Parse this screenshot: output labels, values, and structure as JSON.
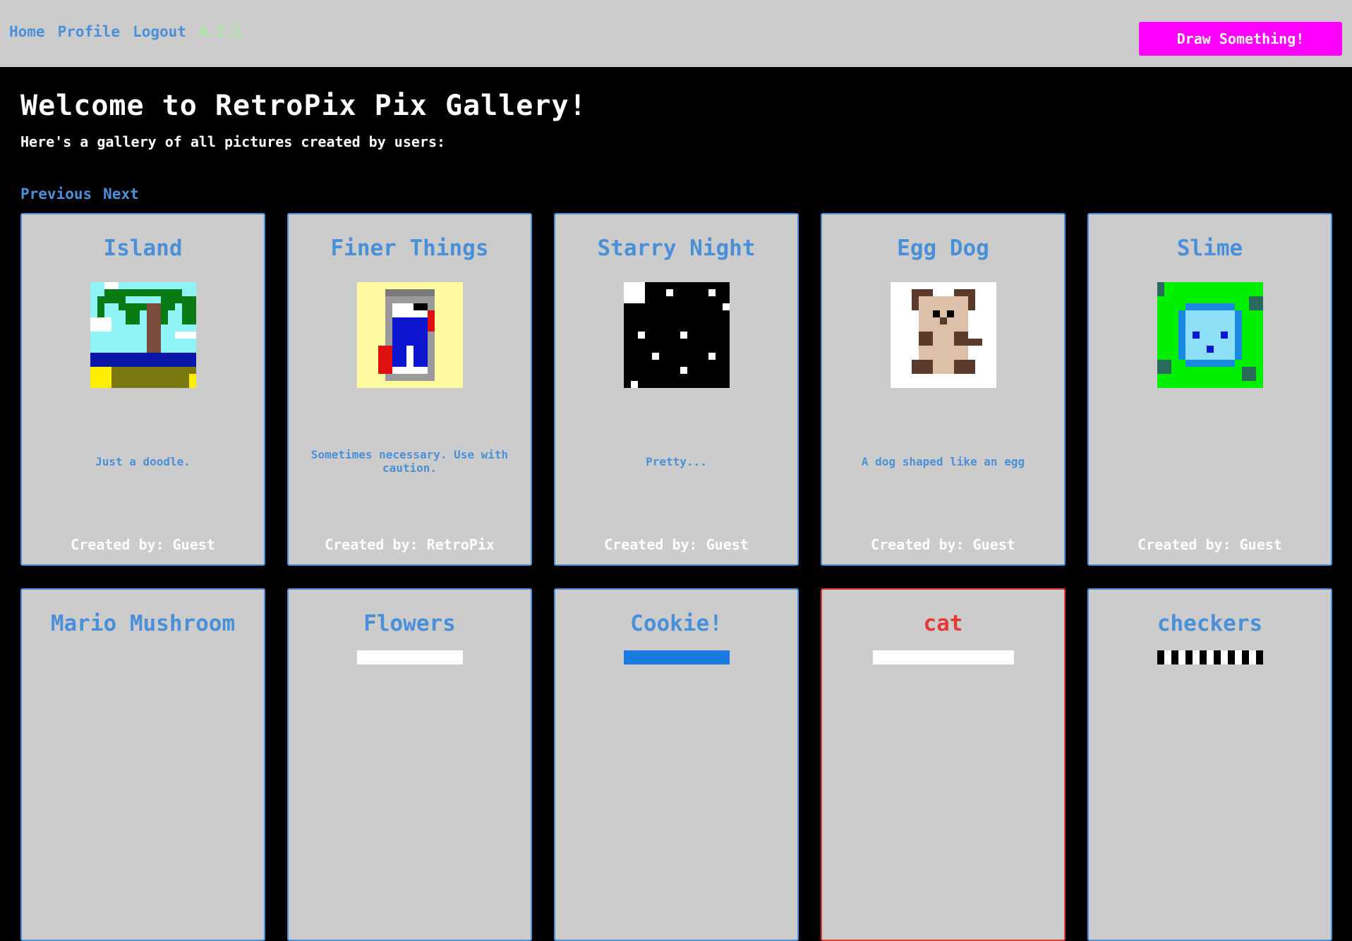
{
  "nav": {
    "home": "Home",
    "profile": "Profile",
    "logout": "Logout",
    "ail": "A.I.L"
  },
  "draw_button": "Draw Something!",
  "heading": "Welcome to RetroPix Pix Gallery!",
  "subtitle": "Here's a gallery of all pictures created by users:",
  "pager": {
    "previous": "Previous",
    "next": "Next"
  },
  "cards": [
    {
      "title": "Island",
      "desc": "Just a doodle.",
      "creator": "Created by: Guest"
    },
    {
      "title": "Finer Things",
      "desc": "Sometimes necessary. Use with caution.",
      "creator": "Created by: RetroPix"
    },
    {
      "title": "Starry Night",
      "desc": "Pretty...",
      "creator": "Created by: Guest"
    },
    {
      "title": "Egg Dog",
      "desc": "A dog shaped like an egg",
      "creator": "Created by: Guest"
    },
    {
      "title": "Slime",
      "desc": "",
      "creator": "Created by: Guest"
    },
    {
      "title": "Mario Mushroom"
    },
    {
      "title": "Flowers"
    },
    {
      "title": "Cookie!"
    },
    {
      "title": "cat"
    },
    {
      "title": "checkers"
    }
  ],
  "colors": {
    "accent": "#4a90d9",
    "cta": "#ff00ff",
    "ail": "#a8e6a1",
    "highlight_border": "#e53935"
  }
}
